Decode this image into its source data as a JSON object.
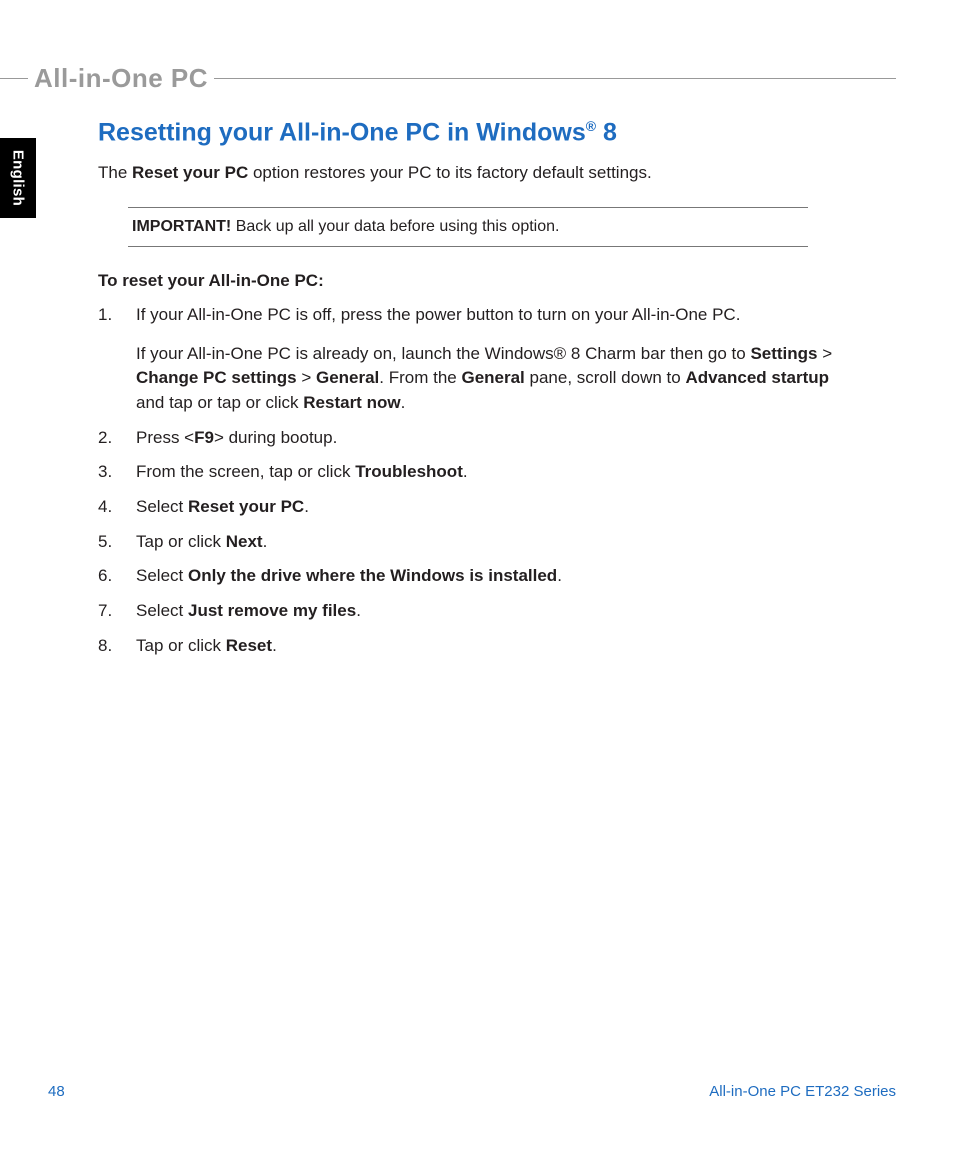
{
  "header": {
    "brand": "All-in-One PC"
  },
  "side_tab": {
    "language": "English"
  },
  "title": {
    "pre": "Resetting your All-in-One PC in Windows",
    "reg": "®",
    "post": " 8"
  },
  "intro": {
    "pre": "The ",
    "bold": "Reset your PC",
    "post": " option restores your PC to its factory default settings."
  },
  "important": {
    "label": "IMPORTANT!",
    "text": "   Back up all your data before using this option."
  },
  "sub_heading": "To reset your All-in-One PC:",
  "steps": {
    "s1": {
      "p1": "If your All-in-One PC is off, press the power button to turn on your All-in-One PC.",
      "p2": {
        "t1": "If your All-in-One PC is already on, launch the Windows® 8 Charm bar then go to ",
        "b1": "Settings",
        "t2": " > ",
        "b2": "Change PC settings",
        "t3": " > ",
        "b3": "General",
        "t4": ". From the ",
        "b4": "General",
        "t5": " pane, scroll down to ",
        "b5": "Advanced startup",
        "t6": " and tap or tap or click ",
        "b6": "Restart now",
        "t7": "."
      }
    },
    "s2": {
      "t1": "Press <",
      "b1": "F9",
      "t2": "> during bootup."
    },
    "s3": {
      "t1": "From the screen, tap or click ",
      "b1": "Troubleshoot",
      "t2": "."
    },
    "s4": {
      "t1": "Select ",
      "b1": "Reset your PC",
      "t2": "."
    },
    "s5": {
      "t1": "Tap or click ",
      "b1": "Next",
      "t2": "."
    },
    "s6": {
      "t1": "Select ",
      "b1": "Only the drive where the Windows is installed",
      "t2": "."
    },
    "s7": {
      "t1": "Select ",
      "b1": "Just remove my files",
      "t2": "."
    },
    "s8": {
      "t1": "Tap or click ",
      "b1": "Reset",
      "t2": "."
    }
  },
  "footer": {
    "page_number": "48",
    "series": "All-in-One PC ET232 Series"
  }
}
